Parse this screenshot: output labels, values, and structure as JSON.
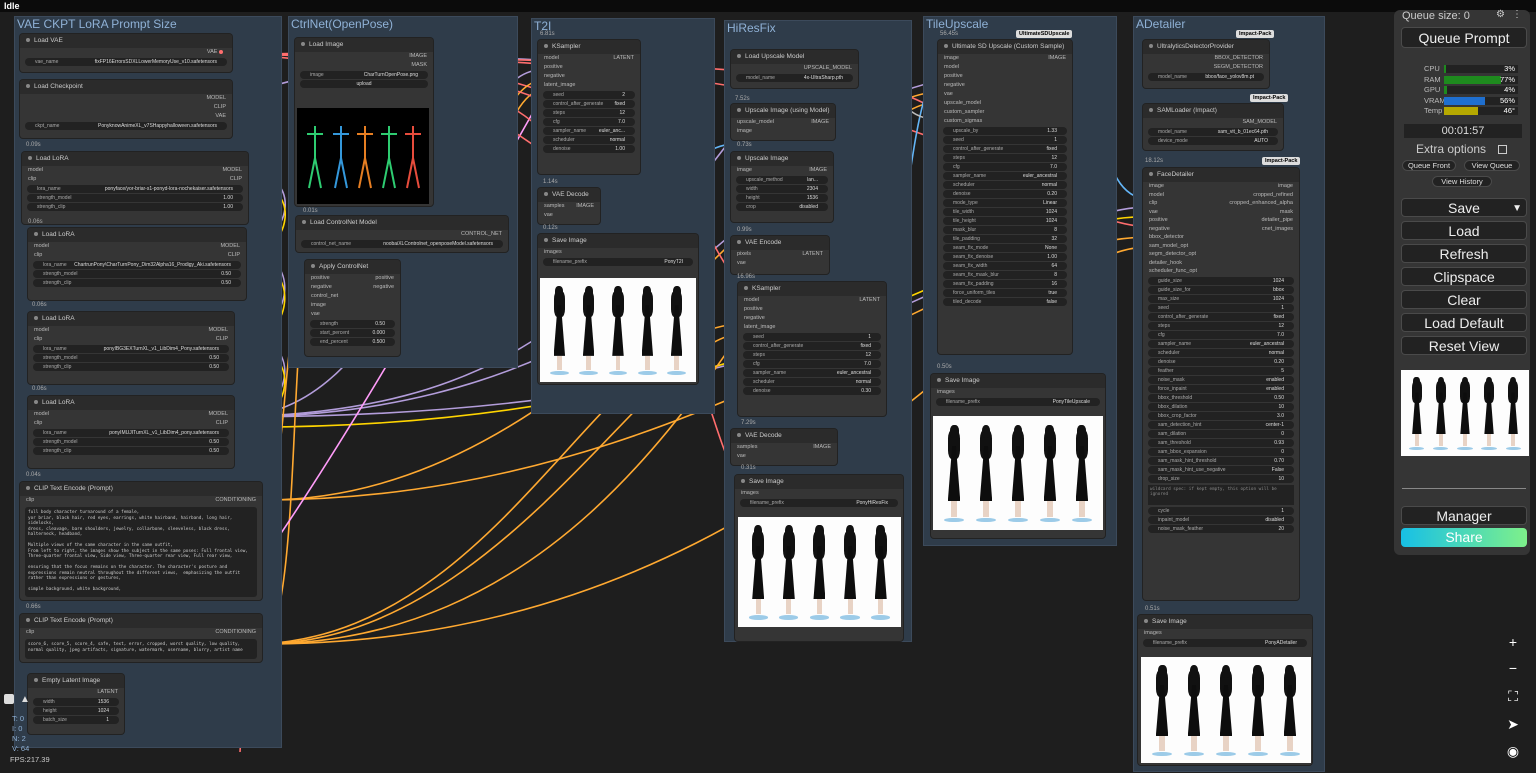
{
  "status": "Idle",
  "groups": {
    "vae": "VAE CKPT LoRA Prompt Size",
    "ctrl": "CtrlNet(OpenPose)",
    "t2i": "T2I",
    "hires": "HiResFix",
    "tile": "TileUpscale",
    "adetail": "ADetailer"
  },
  "load_vae": {
    "title": "Load VAE",
    "out": "VAE",
    "w1l": "vae_name",
    "w1v": "fixFP16ErrorsSDXLLowerMemoryUse_v10.safetensors"
  },
  "ckpt": {
    "title": "Load Checkpoint",
    "o1": "MODEL",
    "o2": "CLIP",
    "o3": "VAE",
    "wl": "ckpt_name",
    "wv": "PonyknowAnimeXL_v7SHappyhalloween.safetensors",
    "time": "0.09s"
  },
  "lora1": {
    "title": "Load LoRA",
    "i1": "model",
    "i2": "clip",
    "o1": "MODEL",
    "o2": "CLIP",
    "name": "ponyface/yor-briar-s1-ponyd-lora-nochekaiser.safetensors",
    "sm_l": "strength_model",
    "sm": "1.00",
    "sc_l": "strength_clip",
    "sc": "1.00",
    "time": "0.06s"
  },
  "lora2": {
    "title": "Load LoRA",
    "name": "ChartrunPony\\CharTurnPony_Dim32Alpha16_Prodigy_Aki.safetensors",
    "sm": "0.50",
    "sc": "0.50",
    "time": "0.06s"
  },
  "lora3": {
    "title": "Load LoRA",
    "name": "ponyIBG3EXTurnXL_v1_LibDim4_Pony.safetensors",
    "sm": "0.50",
    "sc": "0.50",
    "time": "0.06s"
  },
  "lora4": {
    "title": "Load LoRA",
    "name": "ponyIMUJITurnXL_v1_LibDim4_pony.safetensors",
    "sm": "0.50",
    "sc": "0.50",
    "time": "0.04s"
  },
  "clip1": {
    "title": "CLIP Text Encode (Prompt)",
    "i": "clip",
    "o": "CONDITIONING",
    "text": "full body character turnaround of a female,\nyor briar, black hair, red eyes, earrings, white hairband, hairband, long hair,\nsidelocks,\ndress, cleavage, bare shoulders, jewelry, collarbone, sleeveless, black dress,\nhalterneck, headband,\n\nMultiple views of the same character in the same outfit,\nFrom left to right, the images show the subject in the same poses: Full frontal view,\nThree-quarter frontal view, Side view, Three-quarter rear view, Full rear view,\n\nensuring that the focus remains on the character. The character's posture and\nexpressions remain neutral throughout the different views,  emphasizing the outfit\nrather than expressions or gestures,\n\nsimple background, white background,",
    "time": "0.66s"
  },
  "clip2": {
    "title": "CLIP Text Encode (Prompt)",
    "i": "clip",
    "o": "CONDITIONING",
    "text": "score_6, score_5, score_4, safe, text, error, cropped, worst quality, low quality,\nnormal quality, jpeg artifacts, signature, watermark, username, blurry, artist name"
  },
  "latent": {
    "title": "Empty Latent Image",
    "o": "LATENT",
    "wl": "width",
    "wv": "1536",
    "hl": "height",
    "hv": "1024",
    "bl": "batch_size",
    "bv": "1"
  },
  "loadimg": {
    "title": "Load Image",
    "o1": "IMAGE",
    "o2": "MASK",
    "wl": "image",
    "wv": "CharTurnOpenPose.png",
    "up": "upload",
    "time": "0.01s"
  },
  "cnet": {
    "title": "Load ControlNet Model",
    "o": "CONTROL_NET",
    "wl": "control_net_name",
    "wv": "noobaiXLControlnet_openposeModel.safetensors"
  },
  "applycn": {
    "title": "Apply ControlNet",
    "i1": "positive",
    "i2": "negative",
    "i3": "control_net",
    "i4": "image",
    "i5": "vae",
    "o1": "positive",
    "o2": "negative",
    "s_l": "strength",
    "s": "0.50",
    "sp_l": "start_percent",
    "sp": "0.000",
    "ep_l": "end_percent",
    "ep": "0.500"
  },
  "ks1": {
    "title": "KSampler",
    "o": "LATENT",
    "i": [
      "model",
      "positive",
      "negative",
      "latent_image"
    ],
    "w": [
      [
        "seed",
        "2"
      ],
      [
        "control_after_generate",
        "fixed"
      ],
      [
        "steps",
        "12"
      ],
      [
        "cfg",
        "7.0"
      ],
      [
        "sampler_name",
        "euler_anc..."
      ],
      [
        "scheduler",
        "normal"
      ],
      [
        "denoise",
        "1.00"
      ]
    ],
    "time": "6.81s"
  },
  "vd1": {
    "title": "VAE Decode",
    "i1": "samples",
    "i2": "vae",
    "o": "IMAGE",
    "time": "1.14s"
  },
  "si1": {
    "title": "Save Image",
    "i": "images",
    "wl": "filename_prefix",
    "wv": "PonyT2I",
    "time": "0.12s"
  },
  "lum": {
    "title": "Load Upscale Model",
    "o": "UPSCALE_MODEL",
    "wl": "model_name",
    "wv": "4x-UltraSharp.pth",
    "time": "7.52s"
  },
  "uim": {
    "title": "Upscale Image (using Model)",
    "i1": "upscale_model",
    "i2": "image",
    "o": "IMAGE",
    "time": "0.73s"
  },
  "ui": {
    "title": "Upscale Image",
    "i": "image",
    "o": "IMAGE",
    "w": [
      [
        "upscale_method",
        "lan..."
      ],
      [
        "width",
        "2304"
      ],
      [
        "height",
        "1536"
      ],
      [
        "crop",
        "disabled"
      ]
    ],
    "time": "0.99s"
  },
  "ve": {
    "title": "VAE Encode",
    "i1": "pixels",
    "i2": "vae",
    "o": "LATENT",
    "time": "16.96s"
  },
  "ks2": {
    "title": "KSampler",
    "o": "LATENT",
    "i": [
      "model",
      "positive",
      "negative",
      "latent_image"
    ],
    "w": [
      [
        "seed",
        "1"
      ],
      [
        "control_after_generate",
        "fixed"
      ],
      [
        "steps",
        "12"
      ],
      [
        "cfg",
        "7.0"
      ],
      [
        "sampler_name",
        "euler_ancestral"
      ],
      [
        "scheduler",
        "normal"
      ],
      [
        "denoise",
        "0.30"
      ]
    ],
    "time": "7.29s"
  },
  "vd2": {
    "title": "VAE Decode",
    "i1": "samples",
    "i2": "vae",
    "o": "IMAGE",
    "time": "0.31s"
  },
  "si2": {
    "title": "Save Image",
    "i": "images",
    "wl": "filename_prefix",
    "wv": "PonyHiResFix"
  },
  "usd": {
    "title": "Ultimate SD Upscale (Custom Sample)",
    "badge": "UltimateSDUpscale",
    "time": "56.45s",
    "o": "IMAGE",
    "i": [
      "image",
      "model",
      "positive",
      "negative",
      "vae",
      "upscale_model",
      "custom_sampler",
      "custom_sigmas"
    ],
    "w": [
      [
        "upscale_by",
        "1.33"
      ],
      [
        "seed",
        "1"
      ],
      [
        "control_after_generate",
        "fixed"
      ],
      [
        "steps",
        "12"
      ],
      [
        "cfg",
        "7.0"
      ],
      [
        "sampler_name",
        "euler_ancestral"
      ],
      [
        "scheduler",
        "normal"
      ],
      [
        "denoise",
        "0.20"
      ],
      [
        "mode_type",
        "Linear"
      ],
      [
        "tile_width",
        "1024"
      ],
      [
        "tile_height",
        "1024"
      ],
      [
        "mask_blur",
        "8"
      ],
      [
        "tile_padding",
        "32"
      ],
      [
        "seam_fix_mode",
        "None"
      ],
      [
        "seam_fix_denoise",
        "1.00"
      ],
      [
        "seam_fix_width",
        "64"
      ],
      [
        "seam_fix_mask_blur",
        "8"
      ],
      [
        "seam_fix_padding",
        "16"
      ],
      [
        "force_uniform_tiles",
        "true"
      ],
      [
        "tiled_decode",
        "false"
      ]
    ]
  },
  "si3": {
    "title": "Save Image",
    "i": "images",
    "wl": "filename_prefix",
    "wv": "PonyTileUpscale",
    "time": "0.50s"
  },
  "udp": {
    "title": "UltralyticsDetectorProvider",
    "badge": "Impact-Pack",
    "o1": "BBOX_DETECTOR",
    "o2": "SEGM_DETECTOR",
    "wl": "model_name",
    "wv": "bbox/face_yolov8m.pt"
  },
  "sam": {
    "title": "SAMLoader (Impact)",
    "badge": "Impact-Pack",
    "o": "SAM_MODEL",
    "w1l": "model_name",
    "w1v": "sam_vit_b_01ec64.pth",
    "w2l": "device_mode",
    "w2v": "AUTO",
    "time": "18.12s"
  },
  "fd": {
    "title": "FaceDetailer",
    "badge": "Impact-Pack",
    "i": [
      "image",
      "model",
      "clip",
      "vae",
      "positive",
      "negative",
      "bbox_detector",
      "sam_model_opt",
      "segm_detector_opt",
      "detailer_hook",
      "scheduler_func_opt"
    ],
    "o": [
      "image",
      "cropped_refined",
      "cropped_enhanced_alpha",
      "mask",
      "detailer_pipe",
      "cnet_images"
    ],
    "w": [
      [
        "guide_size",
        "1024"
      ],
      [
        "guide_size_for",
        "bbox"
      ],
      [
        "max_size",
        "1024"
      ],
      [
        "seed",
        "1"
      ],
      [
        "control_after_generate",
        "fixed"
      ],
      [
        "steps",
        "12"
      ],
      [
        "cfg",
        "7.0"
      ],
      [
        "sampler_name",
        "euler_ancestral"
      ],
      [
        "scheduler",
        "normal"
      ],
      [
        "denoise",
        "0.20"
      ],
      [
        "feather",
        "5"
      ],
      [
        "noise_mask",
        "enabled"
      ],
      [
        "force_inpaint",
        "enabled"
      ],
      [
        "bbox_threshold",
        "0.50"
      ],
      [
        "bbox_dilation",
        "10"
      ],
      [
        "bbox_crop_factor",
        "3.0"
      ],
      [
        "sam_detection_hint",
        "center-1"
      ],
      [
        "sam_dilation",
        "0"
      ],
      [
        "sam_threshold",
        "0.93"
      ],
      [
        "sam_bbox_expansion",
        "0"
      ],
      [
        "sam_mask_hint_threshold",
        "0.70"
      ],
      [
        "sam_mask_hint_use_negative",
        "False"
      ],
      [
        "drop_size",
        "10"
      ]
    ],
    "wildcard": "wildcard spec: if kept empty, this option will be ignored",
    "w2": [
      [
        "cycle",
        "1"
      ],
      [
        "inpaint_model",
        "disabled"
      ],
      [
        "noise_mask_feather",
        "20"
      ]
    ]
  },
  "si4": {
    "title": "Save Image",
    "i": "images",
    "wl": "filename_prefix",
    "wv": "PonyADetailer",
    "time": "0.51s"
  },
  "panel": {
    "queue": "Queue size: 0",
    "queue_prompt": "Queue Prompt",
    "stats": [
      [
        "CPU",
        "3%",
        3,
        "#1e8a1e"
      ],
      [
        "RAM",
        "77%",
        77,
        "#1e8a1e"
      ],
      [
        "GPU",
        "4%",
        4,
        "#1e8a1e"
      ],
      [
        "VRAM",
        "56%",
        56,
        "#1f6fcf"
      ],
      [
        "Temp",
        "46°",
        46,
        "#b5a800"
      ]
    ],
    "time": "00:01:57",
    "extra": "Extra options",
    "qf": "Queue Front",
    "vq": "View Queue",
    "vh": "View History",
    "save": "Save",
    "load": "Load",
    "refresh": "Refresh",
    "clipspace": "Clipspace",
    "clear": "Clear",
    "load_default": "Load Default",
    "reset_view": "Reset View",
    "manager": "Manager",
    "share": "Share"
  },
  "fps": "FPS:217.39",
  "stats_left": [
    "T: 0",
    "I: 0",
    "N: 2",
    "V: 64"
  ]
}
